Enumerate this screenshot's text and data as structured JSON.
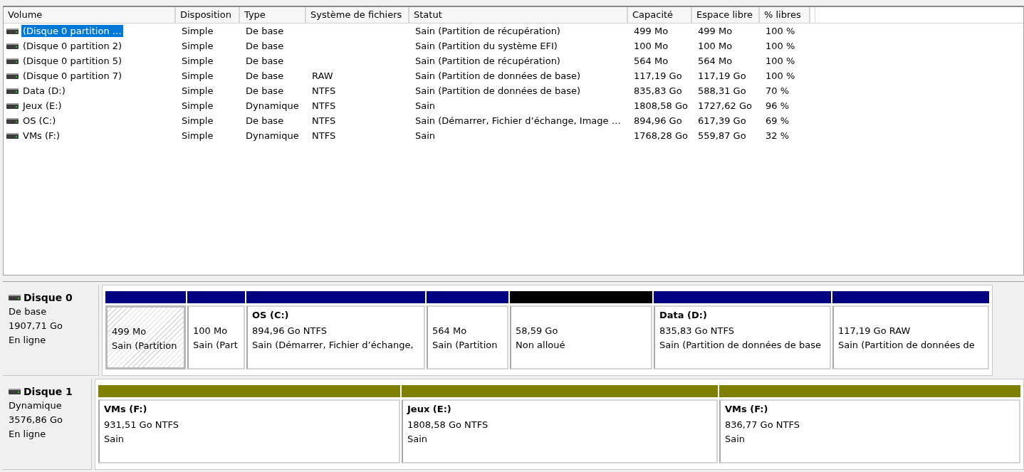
{
  "table": {
    "columns": [
      "Volume",
      "Disposition",
      "Type",
      "Système de fichiers",
      "Statut",
      "Capacité",
      "Espace libre",
      "% libres"
    ],
    "rows": [
      {
        "selected": true,
        "cells": [
          "(Disque 0 partition …",
          "Simple",
          "De base",
          "",
          "Sain (Partition de récupération)",
          "499 Mo",
          "499 Mo",
          "100 %"
        ]
      },
      {
        "selected": false,
        "cells": [
          "(Disque 0 partition 2)",
          "Simple",
          "De base",
          "",
          "Sain (Partition du système EFI)",
          "100 Mo",
          "100 Mo",
          "100 %"
        ]
      },
      {
        "selected": false,
        "cells": [
          "(Disque 0 partition 5)",
          "Simple",
          "De base",
          "",
          "Sain (Partition de récupération)",
          "564 Mo",
          "564 Mo",
          "100 %"
        ]
      },
      {
        "selected": false,
        "cells": [
          "(Disque 0 partition 7)",
          "Simple",
          "De base",
          "RAW",
          "Sain (Partition de données de base)",
          "117,19 Go",
          "117,19 Go",
          "100 %"
        ]
      },
      {
        "selected": false,
        "cells": [
          "Data (D:)",
          "Simple",
          "De base",
          "NTFS",
          "Sain (Partition de données de base)",
          "835,83 Go",
          "588,31 Go",
          "70 %"
        ]
      },
      {
        "selected": false,
        "cells": [
          "Jeux (E:)",
          "Simple",
          "Dynamique",
          "NTFS",
          "Sain",
          "1808,58 Go",
          "1727,62 Go",
          "96 %"
        ]
      },
      {
        "selected": false,
        "cells": [
          "OS (C:)",
          "Simple",
          "De base",
          "NTFS",
          "Sain (Démarrer, Fichier d’échange, Image …",
          "894,96 Go",
          "617,39 Go",
          "69 %"
        ]
      },
      {
        "selected": false,
        "cells": [
          "VMs (F:)",
          "Simple",
          "Dynamique",
          "NTFS",
          "Sain",
          "1768,28 Go",
          "559,87 Go",
          "32 %"
        ]
      }
    ]
  },
  "disks": [
    {
      "name": "Disque 0",
      "type": "De base",
      "size": "1907,71 Go",
      "state": "En ligne",
      "partitions": [
        {
          "kind": "primary",
          "selected": true,
          "size": "499 Mo",
          "status": "Sain (Partition"
        },
        {
          "kind": "primary",
          "selected": false,
          "size": "100 Mo",
          "status": "Sain (Part"
        },
        {
          "kind": "primary",
          "selected": false,
          "title": "OS  (C:)",
          "size": "894,96 Go NTFS",
          "status": "Sain (Démarrer, Fichier d’échange,"
        },
        {
          "kind": "primary",
          "selected": false,
          "size": "564 Mo",
          "status": "Sain (Partition"
        },
        {
          "kind": "unallocated",
          "selected": false,
          "size": "58,59 Go",
          "status": "Non alloué"
        },
        {
          "kind": "primary",
          "selected": false,
          "title": "Data  (D:)",
          "size": "835,83 Go NTFS",
          "status": "Sain (Partition de données de base"
        },
        {
          "kind": "primary",
          "selected": false,
          "size": "117,19 Go RAW",
          "status": "Sain (Partition de données de"
        }
      ]
    },
    {
      "name": "Disque 1",
      "type": "Dynamique",
      "size": "3576,86 Go",
      "state": "En ligne",
      "partitions": [
        {
          "kind": "simple",
          "selected": false,
          "title": "VMs  (F:)",
          "size": "931,51 Go NTFS",
          "status": "Sain"
        },
        {
          "kind": "simple",
          "selected": false,
          "title": "Jeux  (E:)",
          "size": "1808,58 Go NTFS",
          "status": "Sain"
        },
        {
          "kind": "simple",
          "selected": false,
          "title": "VMs  (F:)",
          "size": "836,77 Go NTFS",
          "status": "Sain"
        }
      ]
    }
  ]
}
